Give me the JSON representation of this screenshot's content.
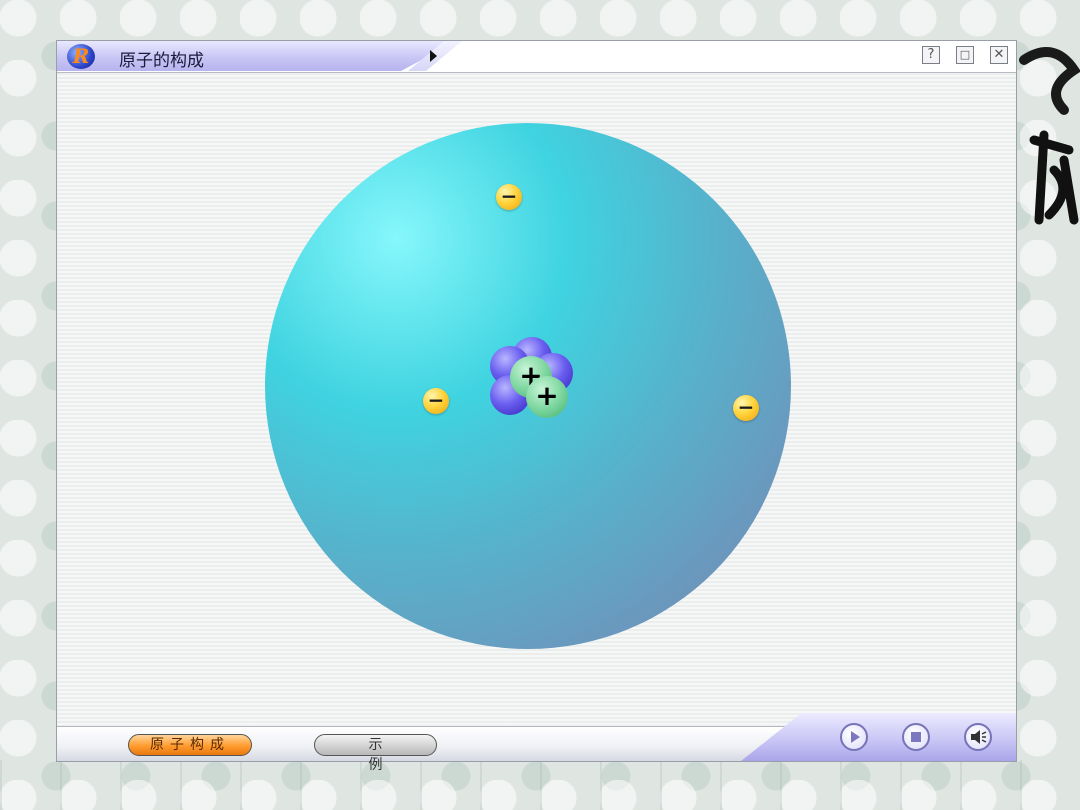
{
  "window": {
    "title": "原子的构成",
    "logo_letter": "R",
    "help_label": "?",
    "restore_label": "□",
    "close_label": "✕"
  },
  "atom": {
    "electron_sign": "−",
    "proton_sign": "+",
    "electrons": 3,
    "protons": 2,
    "neutrons": 4
  },
  "bottom_bar": {
    "tabs": [
      {
        "label": "原子构成",
        "active": true
      },
      {
        "label": "示例",
        "active": false
      }
    ],
    "controls": [
      "play-icon",
      "stop-icon",
      "speaker-icon"
    ]
  },
  "colors": {
    "accent_orange": "#ff9b2e",
    "title_band": "#c9c6f5",
    "cloud_light": "#86f7fb",
    "cloud_dark": "#6b97bd",
    "electron": "#ffd43c",
    "neutron": "#6a5ef0",
    "proton": "#7fd7a0"
  }
}
